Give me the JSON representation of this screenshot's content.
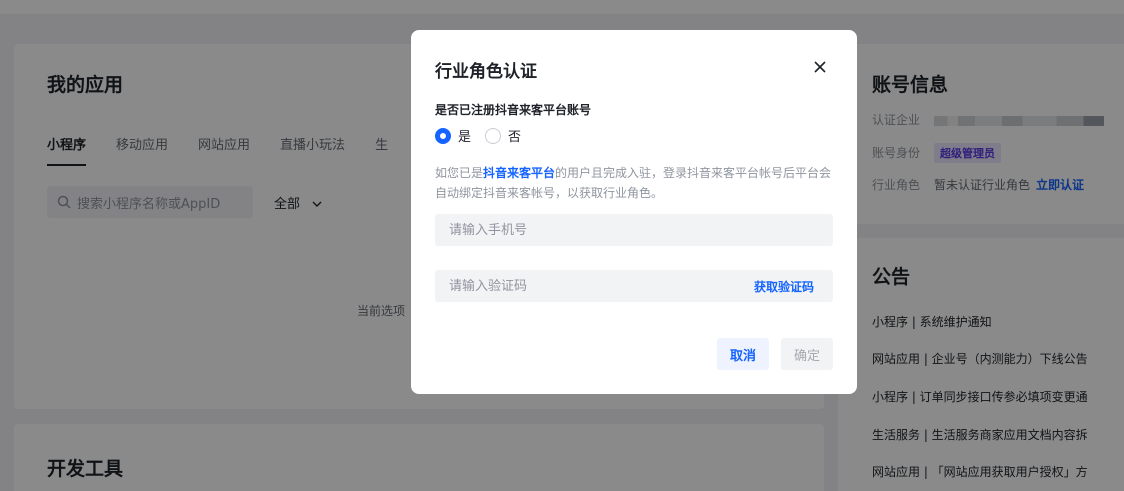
{
  "apps": {
    "title": "我的应用",
    "tabs": [
      "小程序",
      "移动应用",
      "网站应用",
      "直播小玩法",
      "生"
    ],
    "search_placeholder": "搜索小程序名称或AppID",
    "filter_label": "全部",
    "empty_text": "当前选项"
  },
  "tools": {
    "title": "开发工具"
  },
  "account": {
    "title": "账号信息",
    "company_label": "认证企业",
    "identity_label": "账号身份",
    "identity_value": "超级管理员",
    "role_label": "行业角色",
    "role_value": "暂未认证行业角色",
    "role_link": "立即认证"
  },
  "notice": {
    "title": "公告",
    "items": [
      "小程序 | 系统维护通知",
      "网站应用 | 企业号（内测能力）下线公告",
      "小程序 | 订单同步接口传参必填项变更通",
      "生活服务 | 生活服务商家应用文档内容拆",
      "网站应用 | 「网站应用获取用户授权」方"
    ]
  },
  "dialog": {
    "title": "行业角色认证",
    "question": "是否已注册抖音来客平台账号",
    "option_yes": "是",
    "option_no": "否",
    "desc_prefix": "如您已是",
    "desc_highlight": "抖音来客平台",
    "desc_suffix": "的用户且完成入驻，登录抖音来客平台帐号后平台会自动绑定抖音来客帐号，以获取行业角色。",
    "phone_placeholder": "请输入手机号",
    "code_placeholder": "请输入验证码",
    "get_code": "获取验证码",
    "cancel": "取消",
    "confirm": "确定"
  },
  "colors": {
    "accent": "#1664ff",
    "badge_bg": "#eae7fe",
    "badge_fg": "#5b3ae8"
  },
  "icons": {
    "close": "close-icon",
    "search": "search-icon",
    "chevron": "chevron-down-icon"
  }
}
